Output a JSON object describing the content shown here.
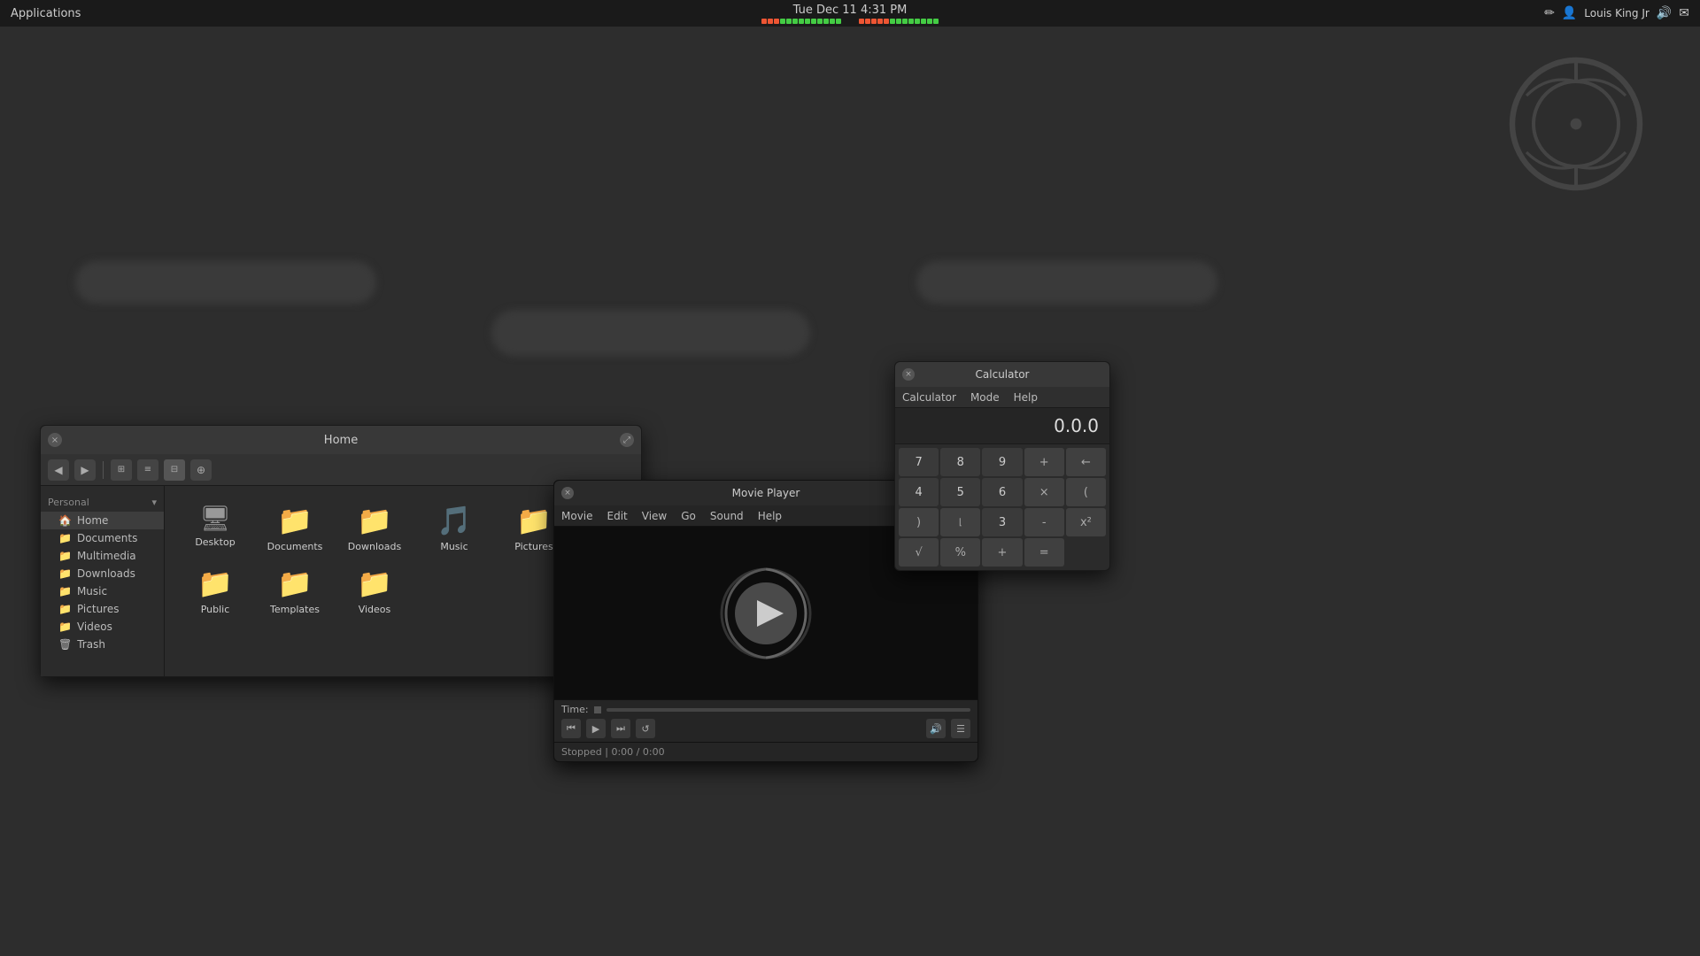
{
  "topbar": {
    "applications_label": "Applications",
    "datetime": "Tue Dec 11  4:31 PM",
    "user": "Louis King Jr",
    "audio_bars_left": [
      {
        "color": "red"
      },
      {
        "color": "red"
      },
      {
        "color": "red"
      },
      {
        "color": "green"
      },
      {
        "color": "green"
      },
      {
        "color": "green"
      },
      {
        "color": "green"
      },
      {
        "color": "green"
      },
      {
        "color": "green"
      },
      {
        "color": "green"
      },
      {
        "color": "green"
      },
      {
        "color": "green"
      },
      {
        "color": "green"
      }
    ],
    "audio_bars_right": [
      {
        "color": "red"
      },
      {
        "color": "red"
      },
      {
        "color": "red"
      },
      {
        "color": "red"
      },
      {
        "color": "red"
      },
      {
        "color": "green"
      },
      {
        "color": "green"
      },
      {
        "color": "green"
      },
      {
        "color": "green"
      },
      {
        "color": "green"
      },
      {
        "color": "green"
      },
      {
        "color": "green"
      },
      {
        "color": "green"
      }
    ]
  },
  "file_manager": {
    "title": "Home",
    "sidebar": {
      "header": "Personal",
      "items": [
        {
          "label": "Home",
          "active": true
        },
        {
          "label": "Documents"
        },
        {
          "label": "Multimedia"
        },
        {
          "label": "Downloads"
        },
        {
          "label": "Music"
        },
        {
          "label": "Pictures"
        },
        {
          "label": "Videos"
        },
        {
          "label": "Trash"
        }
      ]
    },
    "files": [
      {
        "label": "Desktop",
        "type": "monitor"
      },
      {
        "label": "Documents",
        "type": "folder"
      },
      {
        "label": "Downloads",
        "type": "folder"
      },
      {
        "label": "Music",
        "type": "folder-music"
      },
      {
        "label": "Pictures",
        "type": "folder"
      },
      {
        "label": "Public",
        "type": "folder"
      },
      {
        "label": "Templates",
        "type": "folder"
      },
      {
        "label": "Videos",
        "type": "folder"
      }
    ]
  },
  "movie_player": {
    "title": "Movie Player",
    "menu": [
      "Movie",
      "Edit",
      "View",
      "Go",
      "Sound",
      "Help"
    ],
    "status": "Stopped",
    "time_display": "0:00 / 0:00",
    "time_label": "Time:"
  },
  "calculator": {
    "title": "Calculator",
    "menu": [
      "Calculator",
      "Mode",
      "Help"
    ],
    "display": "0.0.0",
    "buttons": [
      [
        "7",
        "8",
        "9",
        "+",
        "←"
      ],
      [
        "4",
        "5",
        "6",
        "×",
        "("
      ],
      [
        " ",
        "3",
        "-",
        "x²",
        "√"
      ],
      [
        "%",
        "+",
        "=",
        "",
        ""
      ]
    ],
    "buttons_flat": [
      {
        "label": "7",
        "type": "num"
      },
      {
        "label": "8",
        "type": "num"
      },
      {
        "label": "9",
        "type": "num"
      },
      {
        "label": "+",
        "type": "op"
      },
      {
        "label": "←",
        "type": "op"
      },
      {
        "label": "4",
        "type": "num"
      },
      {
        "label": "5",
        "type": "num"
      },
      {
        "label": "6",
        "type": "num"
      },
      {
        "label": "×",
        "type": "op"
      },
      {
        "label": "(",
        "type": "op"
      },
      {
        "label": ")",
        "type": "op"
      },
      {
        "label": "",
        "type": "op"
      },
      {
        "label": "3",
        "type": "num"
      },
      {
        "label": "-",
        "type": "op"
      },
      {
        "label": "x²",
        "type": "op"
      },
      {
        "label": "√",
        "type": "op"
      },
      {
        "label": "%",
        "type": "op"
      },
      {
        "label": "+",
        "type": "op"
      },
      {
        "label": "=",
        "type": "op"
      }
    ]
  }
}
